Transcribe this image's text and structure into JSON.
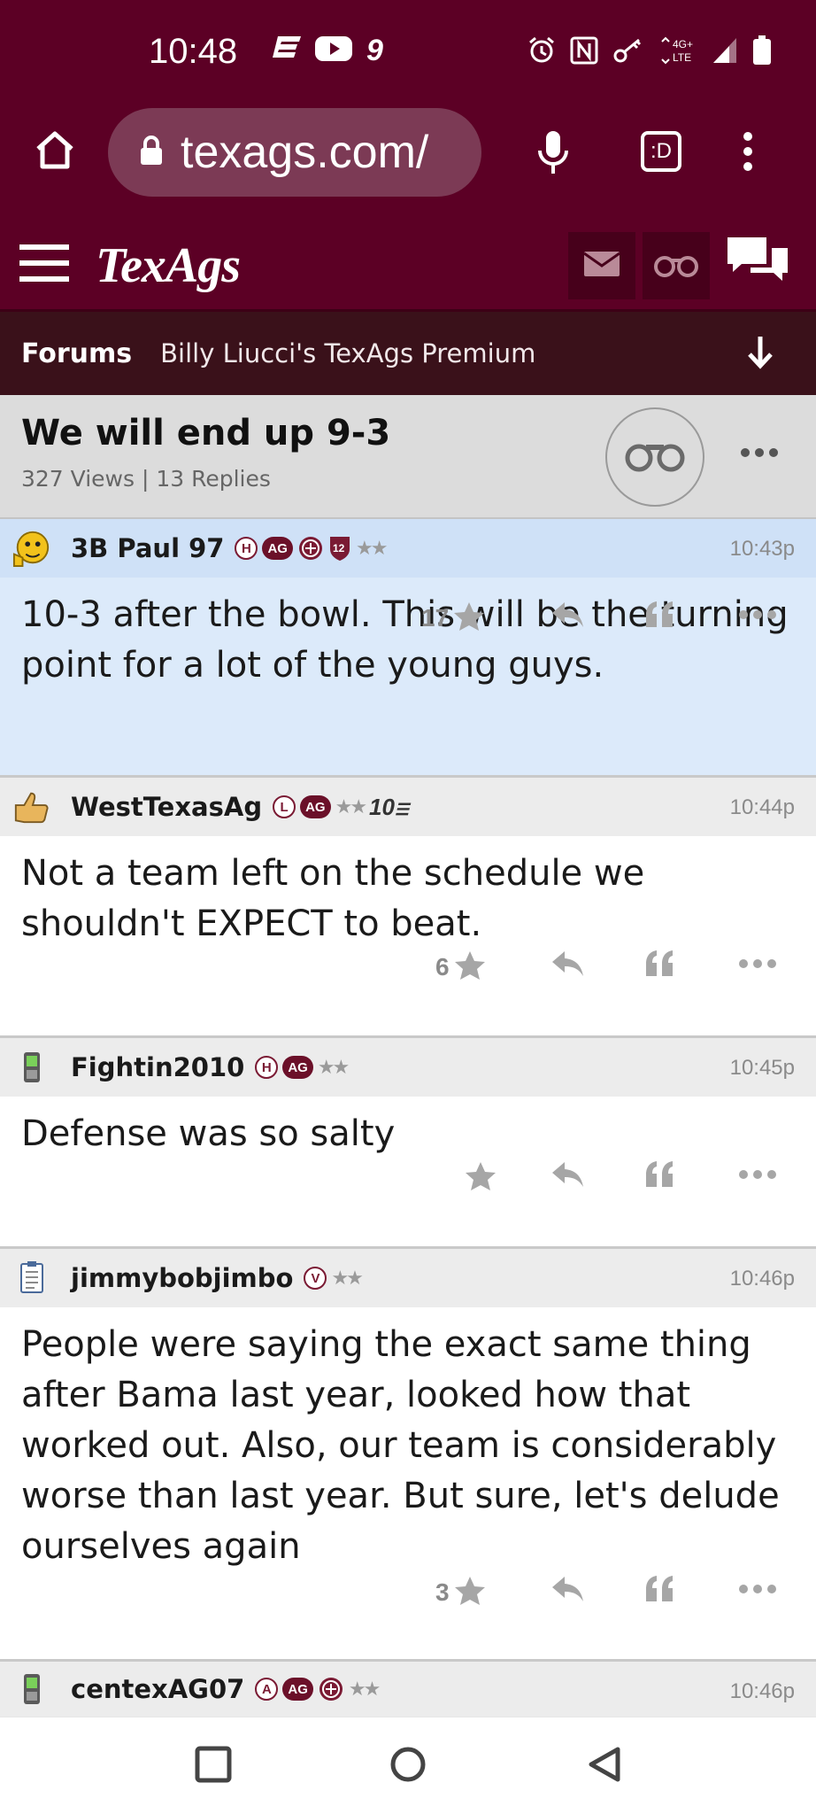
{
  "status_bar": {
    "time": "10:48",
    "network": "4G+ LTE"
  },
  "browser": {
    "url": "texags.com/",
    "tabs_label": ":D"
  },
  "site": {
    "logo": "TexAgs"
  },
  "breadcrumb": {
    "forums": "Forums",
    "board": "Billy Liucci's TexAgs Premium"
  },
  "thread": {
    "title": "We will end up 9-3",
    "stats": "327 Views | 13 Replies"
  },
  "posts": [
    {
      "username": "3B Paul 97",
      "badges": [
        "H",
        "AG",
        "seal",
        "12",
        "stars"
      ],
      "time": "10:43p",
      "body": "10-3 after the bowl. This will be the turning point for a lot of the young guys.",
      "likes": "17",
      "highlight": true
    },
    {
      "username": "WestTexasAg",
      "badges": [
        "L",
        "AG",
        "stars",
        "10"
      ],
      "time": "10:44p",
      "body": "Not a team left on the schedule we shouldn't EXPECT to beat.",
      "likes": "6",
      "highlight": false
    },
    {
      "username": "Fightin2010",
      "badges": [
        "H",
        "AG",
        "stars"
      ],
      "time": "10:45p",
      "body": "Defense was so salty",
      "likes": "",
      "highlight": false
    },
    {
      "username": "jimmybobjimbo",
      "badges": [
        "V",
        "stars"
      ],
      "time": "10:46p",
      "body": "People were saying the exact same thing after Bama last year, looked how that worked out. Also, our team is considerably worse than last year. But sure, let's delude ourselves again",
      "likes": "3",
      "highlight": false
    },
    {
      "username": "centexAG07",
      "badges": [
        "A",
        "AG",
        "seal",
        "stars"
      ],
      "time": "10:46p",
      "body": "",
      "likes": "",
      "highlight": false
    }
  ],
  "badge_text": {
    "h": "H",
    "ag": "AG",
    "l": "L",
    "v": "V",
    "a": "A",
    "twelve": "12",
    "ten": "10",
    "stars": "★★"
  },
  "colors": {
    "maroon": "#5c0025",
    "breadcrumb_bg": "#3a111a",
    "highlight_post": "#dceafa",
    "icon_gray": "#a6a6a6"
  }
}
